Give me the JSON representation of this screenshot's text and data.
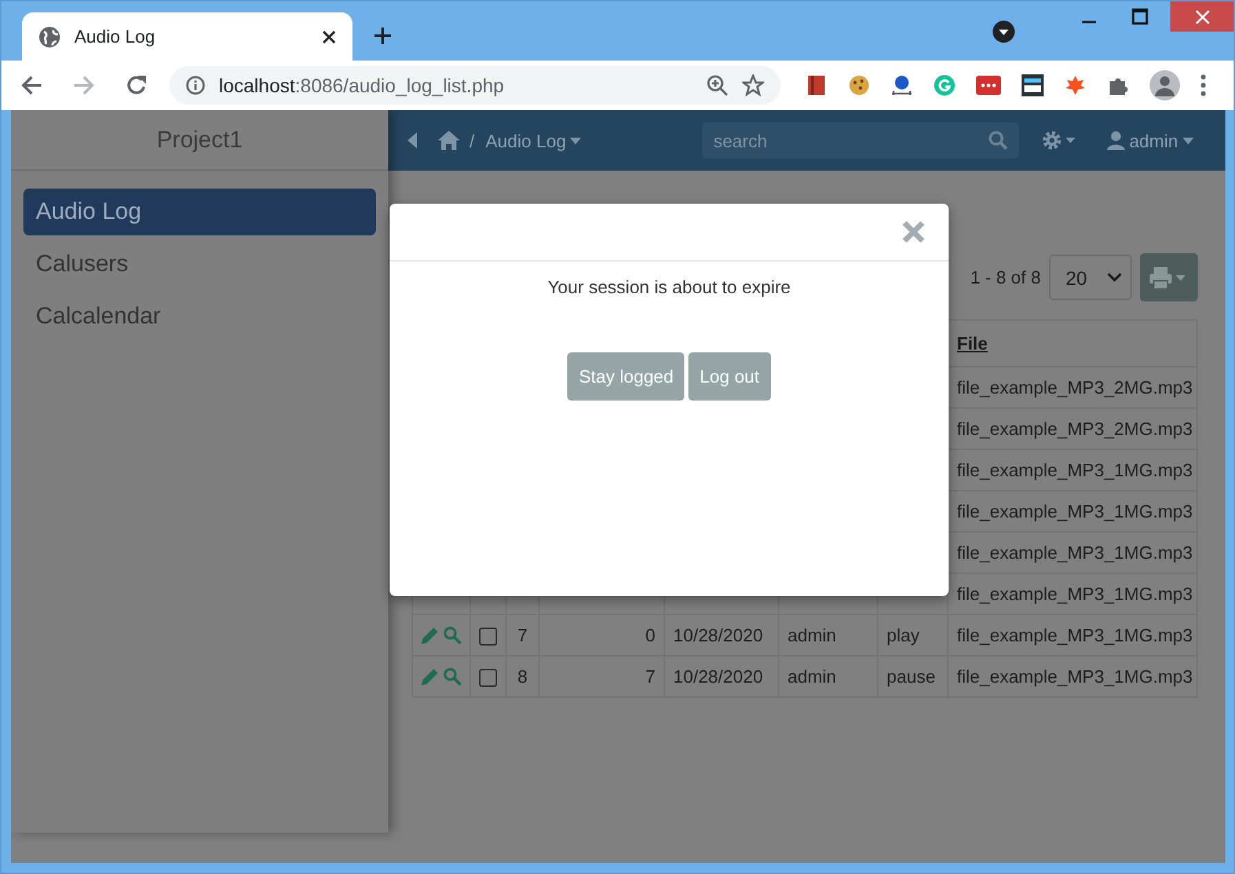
{
  "browser": {
    "tab_title": "Audio Log",
    "url_host": "localhost",
    "url_rest": ":8086/audio_log_list.php"
  },
  "sidebar": {
    "title": "Project1",
    "items": [
      {
        "label": "Audio Log",
        "selected": true
      },
      {
        "label": "Calusers",
        "selected": false
      },
      {
        "label": "Calcalendar",
        "selected": false
      }
    ]
  },
  "navbar": {
    "separator": "/",
    "breadcrumb": "Audio Log",
    "search": {
      "placeholder": "search"
    },
    "user": "admin"
  },
  "pagination": {
    "range": "1 - 8 of 8",
    "page_size": "20"
  },
  "table": {
    "columns": [
      "File"
    ],
    "rows": [
      {
        "file": "file_example_MP3_2MG.mp3"
      },
      {
        "file": "file_example_MP3_2MG.mp3"
      },
      {
        "file": "file_example_MP3_1MG.mp3"
      },
      {
        "file": "file_example_MP3_1MG.mp3"
      },
      {
        "file": "file_example_MP3_1MG.mp3"
      },
      {
        "file": "file_example_MP3_1MG.mp3"
      },
      {
        "checked": false,
        "id": "7",
        "column_4": "0",
        "date": "10/28/2020",
        "user": "admin",
        "action": "play",
        "file": "file_example_MP3_1MG.mp3"
      },
      {
        "checked": false,
        "id": "8",
        "column_4": "7",
        "date": "10/28/2020",
        "user": "admin",
        "action": "pause",
        "file": "file_example_MP3_1MG.mp3"
      }
    ]
  },
  "modal": {
    "message": "Your session is about to expire",
    "buttons": [
      "Stay logged",
      "Log out"
    ]
  }
}
